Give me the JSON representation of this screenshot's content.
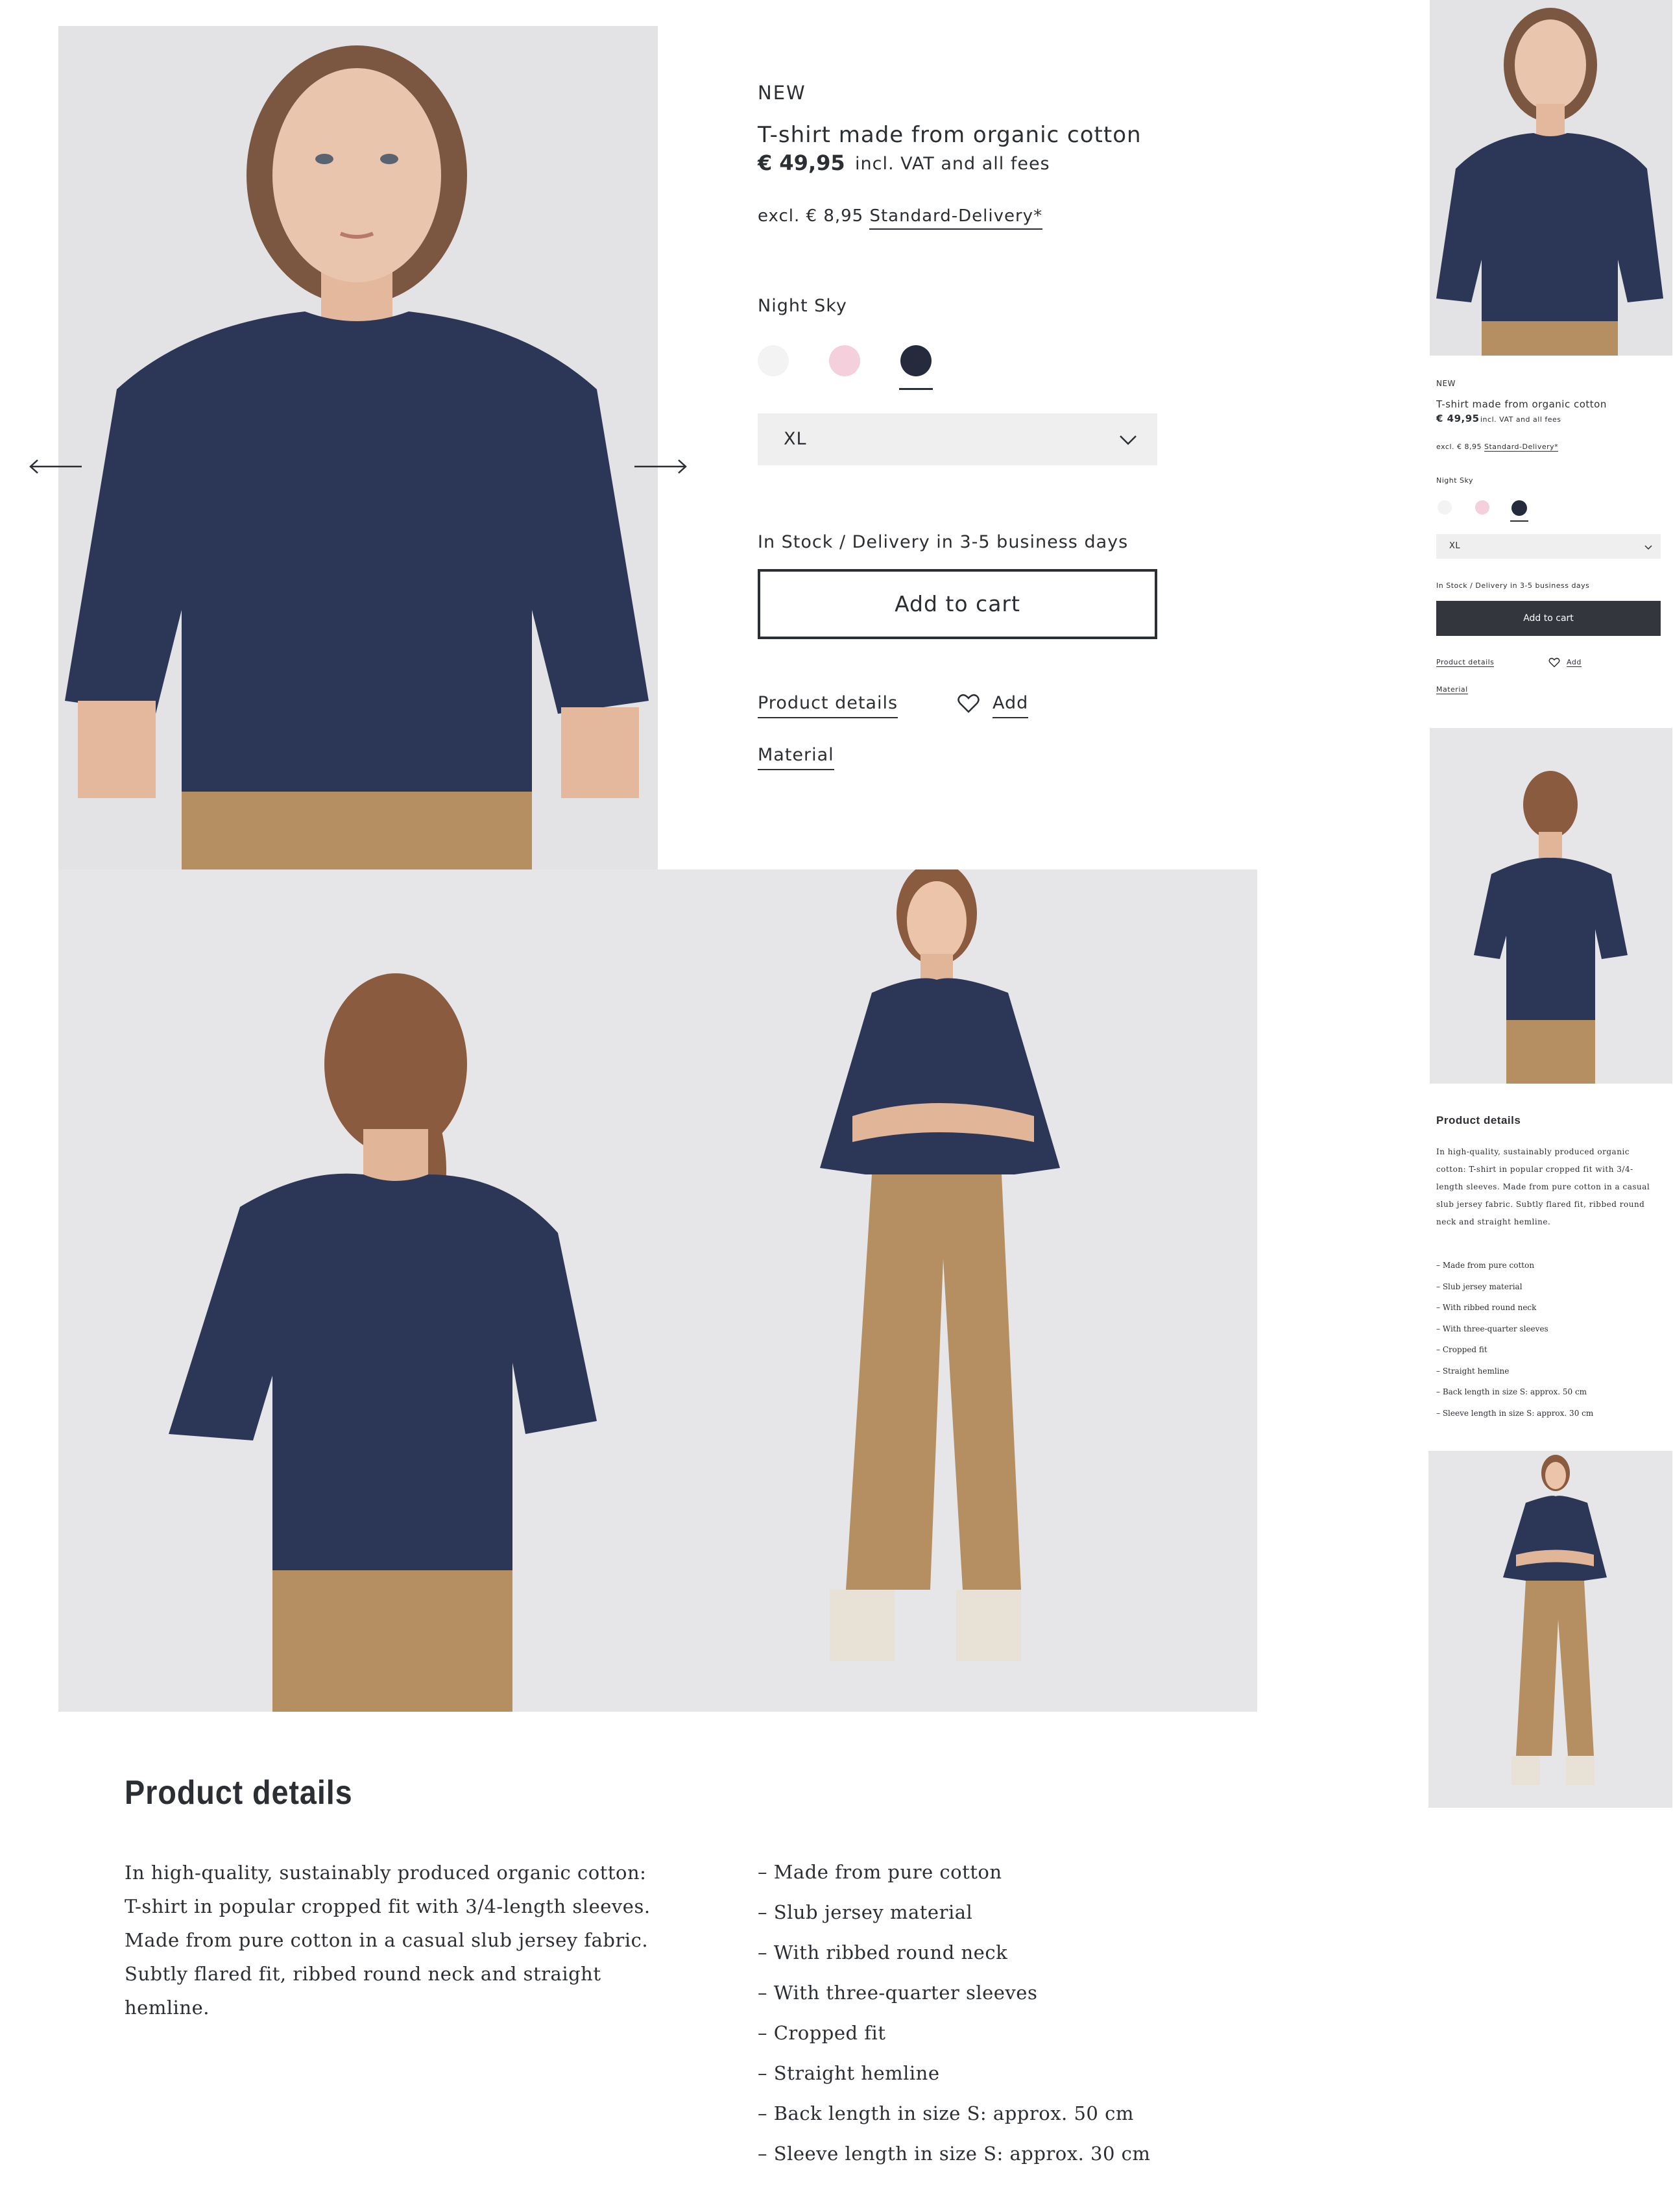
{
  "product": {
    "badge": "NEW",
    "title": "T-shirt made from organic cotton",
    "price": "€ 49,95",
    "vat_note": "incl. VAT and all fees",
    "shipping_prefix": "excl. € 8,95",
    "shipping_link": "Standard-Delivery*",
    "color_label": "Night Sky",
    "swatches": [
      {
        "name": "white",
        "color": "#f3f3f3"
      },
      {
        "name": "pink",
        "color": "#f4cfdc"
      },
      {
        "name": "night-sky",
        "color": "#252a3d",
        "selected": true
      }
    ],
    "size": "XL",
    "stock": "In Stock / Delivery in 3-5 business days",
    "cart_button": "Add to cart",
    "details_link": "Product details",
    "wishlist_label": "Add",
    "material_link": "Material"
  },
  "details": {
    "heading": "Product details",
    "description": "In high-quality, sustainably produced organic cotton: T-shirt in popular cropped fit with 3/4-length sleeves. Made from pure cotton in a casual slub jersey fabric. Subtly flared fit, ribbed round neck and straight hemline.",
    "bullets": [
      "– Made from pure cotton",
      "– Slub jersey material",
      "– With ribbed round neck",
      "– With three-quarter sleeves",
      "– Cropped fit",
      "– Straight hemline",
      "– Back length in size S: approx. 50 cm",
      "– Sleeve length in size S: approx. 30 cm"
    ]
  },
  "colors": {
    "text": "#2b2e33",
    "shirt": "#2c3657",
    "pants": "#b58f62",
    "photo_bg": "#e4e4e6",
    "mobile_button": "#33373d"
  },
  "icons": [
    "arrow-left-icon",
    "arrow-right-icon",
    "chevron-down-icon",
    "heart-icon"
  ]
}
